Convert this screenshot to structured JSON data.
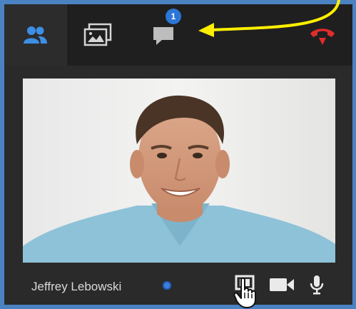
{
  "toolbar": {
    "tabs": [
      {
        "name": "participants",
        "icon": "people-icon",
        "active": true
      },
      {
        "name": "gallery",
        "icon": "image-icon"
      },
      {
        "name": "chat",
        "icon": "chat-bubble-icon",
        "badge": "1"
      },
      {
        "name": "hangup",
        "icon": "hangup-phone-icon"
      }
    ]
  },
  "participant": {
    "name": "Jeffrey Lebowski",
    "status": "online"
  },
  "controls": [
    {
      "name": "share-screen",
      "icon": "screen-share-icon"
    },
    {
      "name": "camera",
      "icon": "video-camera-icon"
    },
    {
      "name": "microphone",
      "icon": "microphone-icon"
    }
  ],
  "colors": {
    "accent": "#3d8fe6",
    "badge": "#2b76d6",
    "hangup": "#e02c2c",
    "annotation": "#ffee00",
    "frame": "#4b82c2",
    "panel": "#2a2a2a",
    "toolbar": "#1f1f1f",
    "status_dot": "#3d7fe0"
  }
}
